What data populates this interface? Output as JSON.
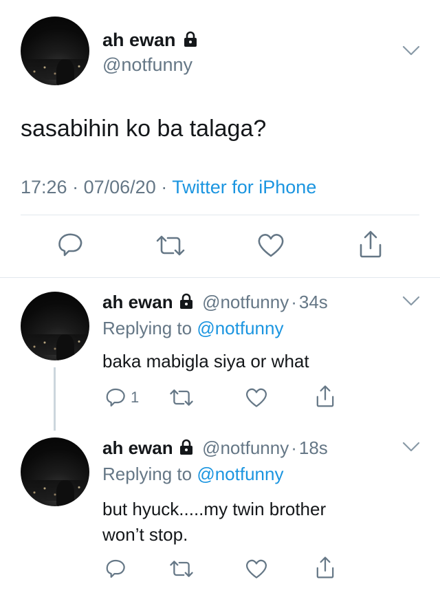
{
  "main_tweet": {
    "display_name": "ah ewan",
    "handle": "@notfunny",
    "text": "sasabihin ko ba talaga?",
    "time": "17:26",
    "sep1": "·",
    "date": "07/06/20",
    "sep2": "·",
    "source": "Twitter for iPhone"
  },
  "replies": [
    {
      "display_name": "ah ewan",
      "handle": "@notfunny",
      "dot": "·",
      "age": "34s",
      "replying_prefix": "Replying to",
      "replying_to": "@notfunny",
      "text": "baka mabigla siya or what",
      "reply_count": "1"
    },
    {
      "display_name": "ah ewan",
      "handle": "@notfunny",
      "dot": "·",
      "age": "18s",
      "replying_prefix": "Replying to",
      "replying_to": "@notfunny",
      "text_line1": "but hyuck.....my twin brother",
      "text_line2": "won’t stop."
    }
  ],
  "icons": {
    "reply": "reply-icon",
    "retweet": "retweet-icon",
    "like": "heart-icon",
    "share": "share-icon",
    "lock": "lock-icon",
    "more": "chevron-down-icon"
  },
  "colors": {
    "link": "#1b95e0",
    "secondary": "#657786",
    "divider": "#e1e8ed"
  }
}
